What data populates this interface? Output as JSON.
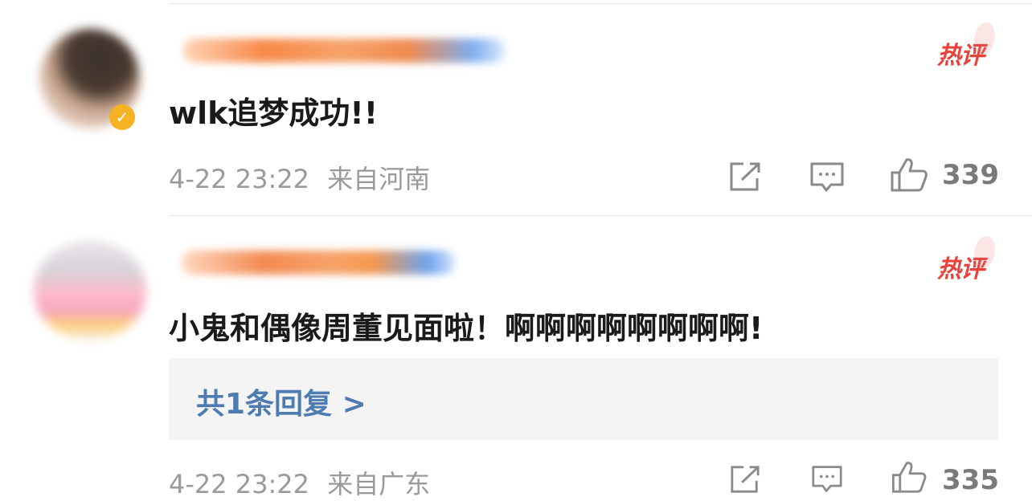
{
  "comments": [
    {
      "text": "wlk追梦成功!!",
      "hot_label": "热评",
      "time": "4-22 23:22",
      "location": "来自河南",
      "likes": "339",
      "verified": true
    },
    {
      "text": "小鬼和偶像周董见面啦！啊啊啊啊啊啊啊啊!",
      "hot_label": "热评",
      "time": "4-22 23:22",
      "location": "来自广东",
      "likes": "335",
      "reply_link": "共1条回复 >"
    }
  ],
  "icons": {
    "share": "share-icon",
    "comment": "comment-icon",
    "like": "thumbs-up-icon"
  },
  "colors": {
    "hot": "#e8423b",
    "link": "#4e7bb0",
    "meta": "#9a9a9a"
  }
}
